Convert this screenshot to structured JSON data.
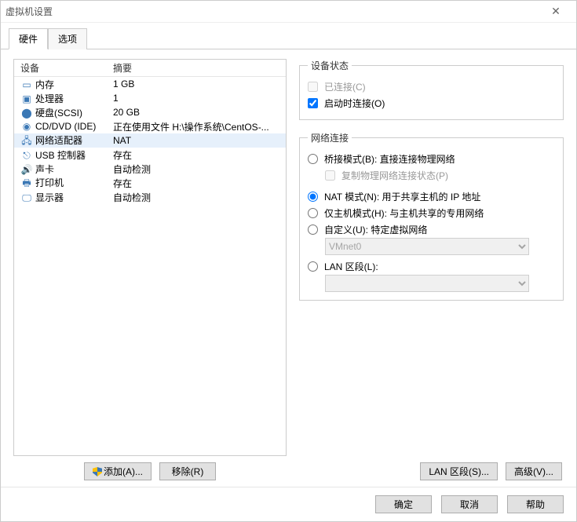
{
  "window": {
    "title": "虚拟机设置"
  },
  "tabs": {
    "hardware": "硬件",
    "options": "选项",
    "active": "hardware"
  },
  "list": {
    "col_device": "设备",
    "col_summary": "摘要",
    "rows": [
      {
        "name": "内存",
        "summary": "1 GB",
        "icon": "memory"
      },
      {
        "name": "处理器",
        "summary": "1",
        "icon": "cpu"
      },
      {
        "name": "硬盘(SCSI)",
        "summary": "20 GB",
        "icon": "disk"
      },
      {
        "name": "CD/DVD (IDE)",
        "summary": "正在使用文件 H:\\操作系统\\CentOS-...",
        "icon": "cd"
      },
      {
        "name": "网络适配器",
        "summary": "NAT",
        "icon": "net",
        "selected": true
      },
      {
        "name": "USB 控制器",
        "summary": "存在",
        "icon": "usb"
      },
      {
        "name": "声卡",
        "summary": "自动检测",
        "icon": "sound"
      },
      {
        "name": "打印机",
        "summary": "存在",
        "icon": "printer"
      },
      {
        "name": "显示器",
        "summary": "自动检测",
        "icon": "display"
      }
    ],
    "add_btn": "添加(A)...",
    "remove_btn": "移除(R)"
  },
  "status": {
    "legend": "设备状态",
    "connected": "已连接(C)",
    "connect_on": "启动时连接(O)"
  },
  "net": {
    "legend": "网络连接",
    "bridged": "桥接模式(B): 直接连接物理网络",
    "replicate": "复制物理网络连接状态(P)",
    "nat": "NAT 模式(N): 用于共享主机的 IP 地址",
    "hostonly": "仅主机模式(H): 与主机共享的专用网络",
    "custom": "自定义(U): 特定虚拟网络",
    "vmnet_selected": "VMnet0",
    "lanseg_radio": "LAN 区段(L):",
    "lanseg_btn": "LAN 区段(S)...",
    "adv_btn": "高级(V)..."
  },
  "footer": {
    "ok": "确定",
    "cancel": "取消",
    "help": "帮助"
  }
}
